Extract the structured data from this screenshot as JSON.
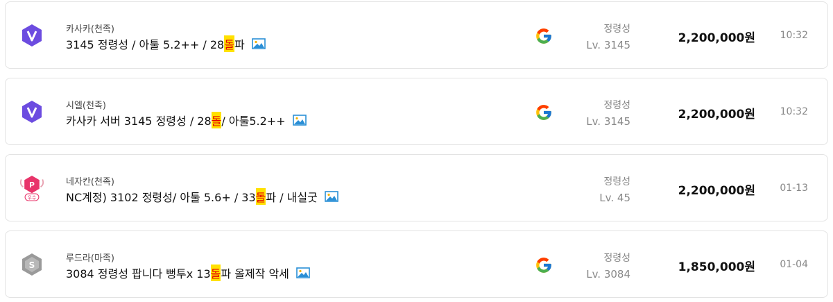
{
  "listings": [
    {
      "seller": "카사카(천족)",
      "title_pre": "3145 정령성 / 아툴 5.2++ / 28",
      "title_hl": "돌",
      "title_post": "파",
      "badge_icon": "v-grade-badge-icon",
      "login_icon": "google-icon",
      "kind": "정령성",
      "level": "Lv. 3145",
      "price": "2,200,000원",
      "time": "10:32"
    },
    {
      "seller": "시엘(천족)",
      "title_pre": "카사카 서버 3145 정령성 / 28",
      "title_hl": "돌",
      "title_post": " / 아툴5.2++",
      "badge_icon": "v-grade-badge-icon",
      "login_icon": "google-icon",
      "kind": "정령성",
      "level": "Lv. 3145",
      "price": "2,200,000원",
      "time": "10:32"
    },
    {
      "seller": "네자칸(천족)",
      "title_pre": "NC계정) 3102 정령성/ 아툴 5.6+ / 33",
      "title_hl": "돌",
      "title_post": "파 / 내실굿",
      "badge_icon": "p-excellent-badge-icon",
      "badge_text": "우수",
      "kind": "정령성",
      "level": "Lv. 45",
      "price": "2,200,000원",
      "time": "01-13"
    },
    {
      "seller": "루드라(마족)",
      "title_pre": "3084 정령성 팝니다 뻥투x 13",
      "title_hl": "돌",
      "title_post": "파 올제작 악세",
      "badge_icon": "s-grade-badge-icon",
      "login_icon": "google-icon",
      "kind": "정령성",
      "level": "Lv. 3084",
      "price": "1,850,000원",
      "time": "01-04"
    }
  ],
  "colors": {
    "highlight_bg": "#ffe100",
    "highlight_text": "#e60000",
    "v_badge": "#6c4ce0",
    "p_badge": "#e8346a",
    "s_badge": "#9a9a9a"
  }
}
